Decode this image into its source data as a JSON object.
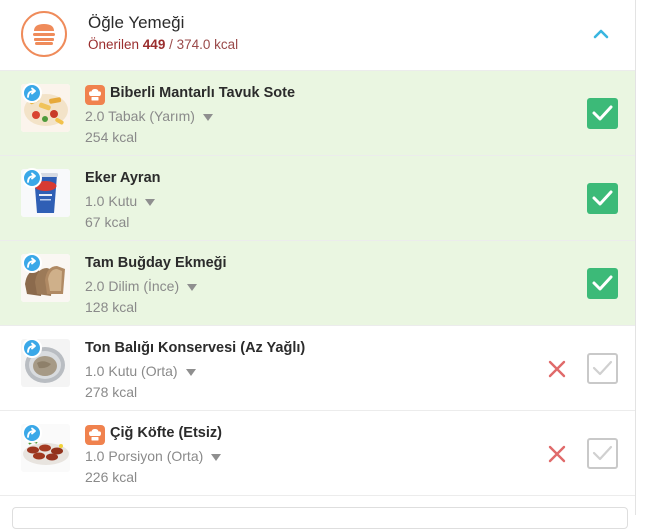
{
  "meal": {
    "title": "Öğle Yemeği",
    "recommended_label": "Önerilen",
    "consumed_kcal": "449",
    "separator": "/",
    "recommended_kcal": "374.0 kcal",
    "icon": "burger-icon",
    "collapse_icon": "chevron-up-icon",
    "accent_color": "#ef8b5a"
  },
  "items": [
    {
      "name": "Biberli Mantarlı Tavuk Sote",
      "portion": "2.0 Tabak (Yarım)",
      "kcal": "254 kcal",
      "recipe": true,
      "checked": true,
      "image": "chicken-saute-dish"
    },
    {
      "name": "Eker Ayran",
      "portion": "1.0 Kutu",
      "kcal": "67 kcal",
      "recipe": false,
      "checked": true,
      "image": "ayran-cup"
    },
    {
      "name": "Tam Buğday Ekmeği",
      "portion": "2.0 Dilim (İnce)",
      "kcal": "128 kcal",
      "recipe": false,
      "checked": true,
      "image": "whole-wheat-bread"
    },
    {
      "name": "Ton Balığı Konservesi (Az Yağlı)",
      "portion": "1.0 Kutu (Orta)",
      "kcal": "278 kcal",
      "recipe": false,
      "checked": false,
      "image": "tuna-can"
    },
    {
      "name": "Çiğ Köfte (Etsiz)",
      "portion": "1.0 Porsiyon (Orta)",
      "kcal": "226 kcal",
      "recipe": true,
      "checked": false,
      "image": "cig-kofte-plate"
    }
  ],
  "colors": {
    "checked_row": "#eaf6e1",
    "check_green": "#3cba78",
    "remove_red": "#e06a6a",
    "swap_badge": "#3aa8e8",
    "recipe_badge": "#f0824e"
  }
}
